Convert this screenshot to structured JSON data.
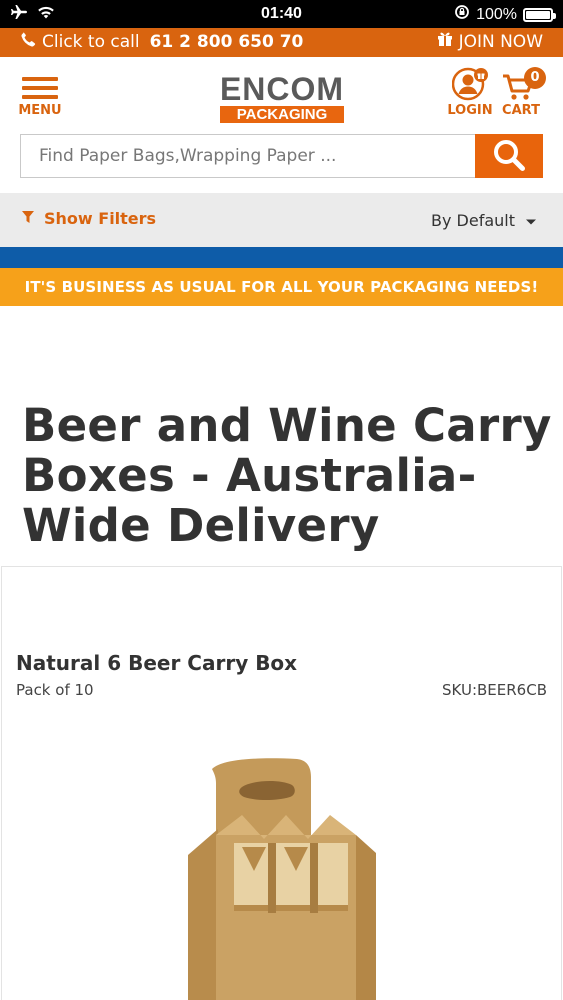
{
  "status_bar": {
    "time": "01:40",
    "battery_percent_text": "100%",
    "battery_level": 1.0
  },
  "top_bar": {
    "call_prefix": "Click to call",
    "phone": "61 2 800 650 70",
    "join_label": "JOIN NOW"
  },
  "header": {
    "menu_label": "MENU",
    "logo_word": "ENCOM",
    "logo_sub": "PACKAGING",
    "login_label": "LOGIN",
    "cart_label": "CART",
    "cart_count": "0"
  },
  "search": {
    "placeholder": "Find Paper Bags,Wrapping Paper ..."
  },
  "filters": {
    "show_filters_label": "Show Filters",
    "sort_value": "By Default"
  },
  "notice": {
    "text": "IT'S BUSINESS AS USUAL FOR ALL YOUR PACKAGING NEEDS!"
  },
  "page": {
    "title": "Beer and Wine Carry Boxes - Australia-Wide Delivery"
  },
  "product": {
    "name": "Natural 6 Beer Carry Box",
    "pack": "Pack of 10",
    "sku": "SKU:BEER6CB"
  },
  "colors": {
    "brand_orange": "#d9640f",
    "notice_yellow": "#f6a11a",
    "strip_blue": "#0e5ca8",
    "kraft": "#c9a566"
  }
}
